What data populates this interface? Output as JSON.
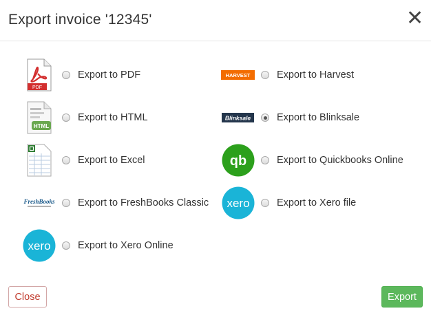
{
  "dialog": {
    "title": "Export invoice '12345'",
    "close_symbol": "✕"
  },
  "options": [
    {
      "id": "pdf",
      "label": "Export to PDF",
      "icon": "pdf-file-icon",
      "logo_text": "PDF",
      "checked": false
    },
    {
      "id": "html",
      "label": "Export to HTML",
      "icon": "html-file-icon",
      "logo_text": "HTML",
      "checked": false
    },
    {
      "id": "excel",
      "label": "Export to Excel",
      "icon": "excel-spreadsheet-icon",
      "checked": false
    },
    {
      "id": "freshbooks",
      "label": "Export to FreshBooks Classic",
      "icon": "freshbooks-logo",
      "logo_text": "FreshBooks",
      "checked": false
    },
    {
      "id": "xero-online",
      "label": "Export to Xero Online",
      "icon": "xero-logo",
      "logo_text": "xero",
      "checked": false
    },
    {
      "id": "harvest",
      "label": "Export to Harvest",
      "icon": "harvest-logo",
      "logo_text": "HARVEST",
      "checked": false
    },
    {
      "id": "blinksale",
      "label": "Export to Blinksale",
      "icon": "blinksale-logo",
      "logo_text": "Blinksale",
      "checked": true
    },
    {
      "id": "quickbooks",
      "label": "Export to Quickbooks Online",
      "icon": "quickbooks-logo",
      "logo_text": "qb",
      "checked": false
    },
    {
      "id": "xero-file",
      "label": "Export to Xero file",
      "icon": "xero-logo",
      "logo_text": "xero",
      "checked": false
    }
  ],
  "footer": {
    "close_label": "Close",
    "export_label": "Export"
  },
  "colors": {
    "export_button": "#5cb85c",
    "close_button_text": "#c0392b",
    "xero_blue": "#1ab4d7",
    "quickbooks_green": "#2ca01c",
    "harvest_orange": "#f36c00",
    "pdf_red": "#d32f2f"
  }
}
